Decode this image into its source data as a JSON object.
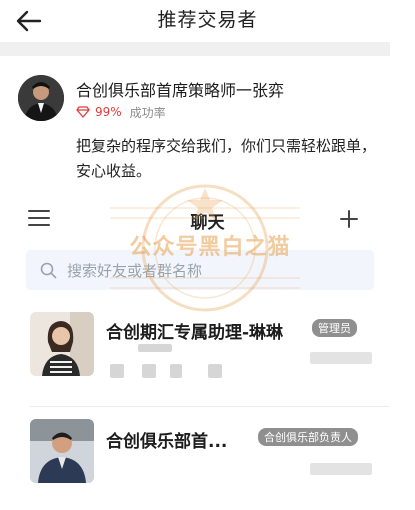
{
  "header": {
    "title": "推荐交易者",
    "back_icon": "arrow-left-icon"
  },
  "trader": {
    "name": "合创俱乐部首席策略师一张弈",
    "success_rate": "99%",
    "success_label": "成功率",
    "description": "把复杂的程序交给我们，你们只需轻松跟单，安心收益。",
    "rate_color": "#e23a3a"
  },
  "chat": {
    "title": "聊天",
    "menu_icon": "menu-icon",
    "add_icon": "plus-icon",
    "search_placeholder": "搜索好友或者群名称"
  },
  "contacts": [
    {
      "name": "合创期汇专属助理-琳琳",
      "badge": "管理员"
    },
    {
      "name": "合创俱乐部首...",
      "badge": "合创俱乐部负责人"
    }
  ],
  "watermark": {
    "text": "公众号黑白之猫"
  }
}
